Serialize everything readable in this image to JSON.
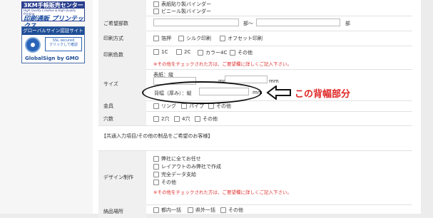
{
  "sidebar": {
    "banner1": {
      "title": "3KM手帳販売センター",
      "sub": "High Quality Creative & High Quality Printing",
      "brand": "印刷通販 プリンテックス"
    },
    "banner2": {
      "title": "グローバルサイン認証サイト",
      "ssl_line1": "SSL secured",
      "ssl_line2": "クリックして確認",
      "foot": "GlobalSign by GMO"
    }
  },
  "binder_options": [
    "表紙貼り製バインダー",
    "ビニール製バインダー"
  ],
  "quantity": {
    "label": "ご希望部数",
    "from_unit": "部～",
    "to_unit": "部"
  },
  "print_method": {
    "label": "印刷方式",
    "options": [
      "箔押",
      "シルク印刷",
      "オフセット印刷"
    ]
  },
  "print_colors": {
    "label": "印刷色数",
    "options": [
      "1C",
      "2C",
      "カラー4C",
      "その他"
    ],
    "note": "※その他をチェックされた方は、ご要望欄に詳しくご記入下さい。"
  },
  "size": {
    "label": "サイズ",
    "sub1": "表紙：縦",
    "unit": "mm",
    "sub2": "背幅（厚み）：縦"
  },
  "hardware": {
    "label": "金具",
    "options": [
      "リング",
      "パイプ",
      "その他"
    ]
  },
  "holes": {
    "label": "穴数",
    "options": [
      "2穴",
      "4穴",
      "その他"
    ]
  },
  "section_title": "【共通入力項目/その他の制品をご希望のお客様】",
  "design": {
    "label": "デザイン制作",
    "options": [
      "弊社に全てお任せ",
      "レイアウトのみ弊社で作成",
      "完全データ支給",
      "その他"
    ],
    "note": "※その他をチェックされた方は、ご要望欄に詳しくご記入下さい。"
  },
  "delivery": {
    "label": "納品場所",
    "options": [
      "都内一括",
      "県外一括",
      "その他"
    ]
  },
  "annotation": {
    "callout": "この背幅部分"
  }
}
